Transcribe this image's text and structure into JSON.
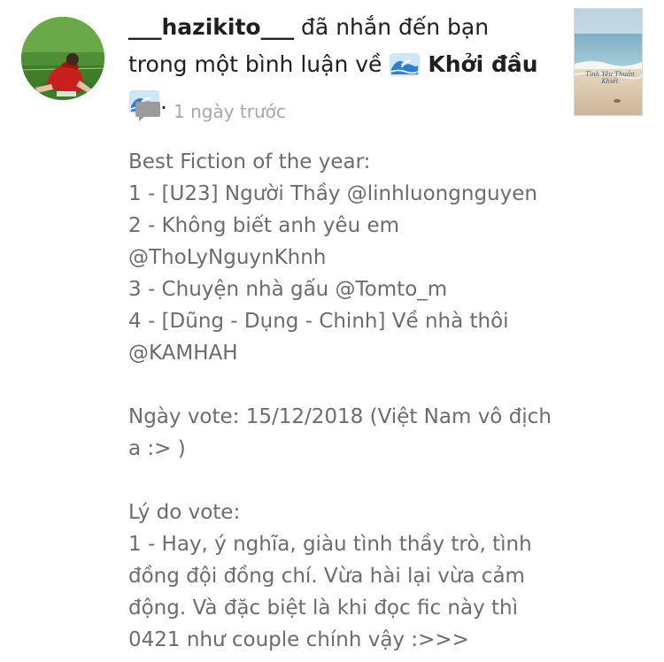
{
  "notification": {
    "username": "___hazikito___",
    "action_text": " đã nhắn đến bạn trong một bình luận về ",
    "story_title": "Khởi đầu",
    "end_punct": ".",
    "emoji": "water-wave-emoji"
  },
  "meta": {
    "icon": "comment-icon",
    "time": "1 ngày trước"
  },
  "cover": {
    "title_text": "Tình Yêu Thuần Khiết"
  },
  "comment": {
    "lines": [
      "Best Fiction of the year:",
      "1 - [U23] Người Thầy @linhluongnguyen",
      "2 - Không biết anh yêu em",
      "@ThoLyNguynKhnh",
      "3 - Chuyện nhà gấu @Tomto_m",
      "4 - [Dũng - Dụng - Chinh] Về nhà thôi",
      "@KAMHAH",
      "",
      "Ngày vote: 15/12/2018 (Việt Nam vô địch",
      "a :> )",
      "",
      "Lý do vote:",
      "1 - Hay, ý nghĩa, giàu tình thầy trò, tình",
      "đồng đội đồng chí. Vừa hài lại vừa cảm",
      "động. Và đặc biệt là khi đọc fic này thì",
      "0421 như couple chính vậy :>>>"
    ]
  },
  "colors": {
    "body_text": "#6c6c6c",
    "meta_text": "#a8a8a8",
    "header_text": "#1f1f1f"
  }
}
